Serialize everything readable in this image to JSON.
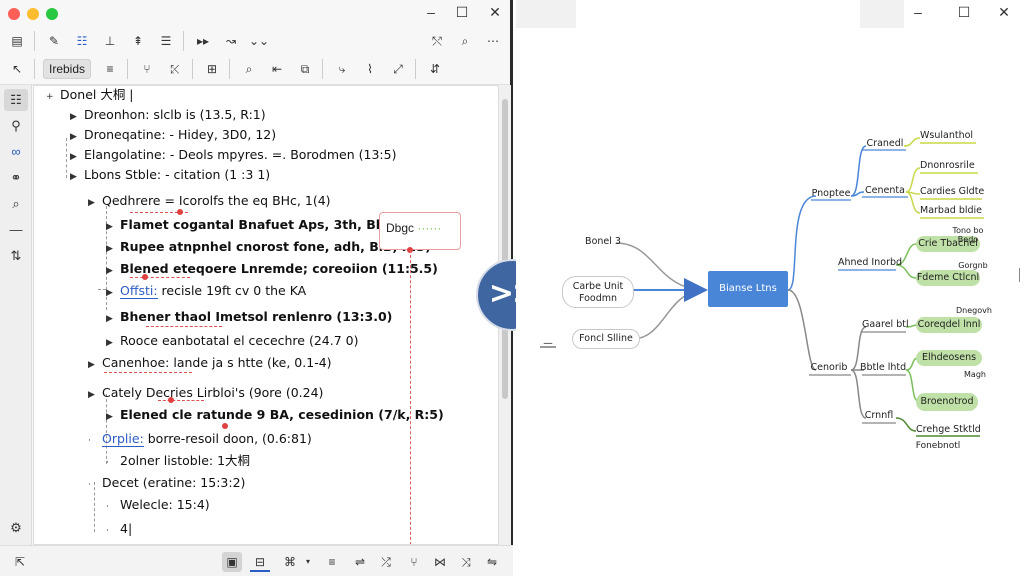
{
  "window": {
    "controls": {
      "minimize": "–",
      "maximize": "☐",
      "close": "✕"
    }
  },
  "toolbar1": {
    "icons": [
      "doc-icon",
      "pen-icon",
      "indent-icon",
      "align-icon",
      "align2-icon",
      "list-icon",
      "more-icon",
      "arrow-icon",
      "chevron-icon",
      "format-icon",
      "search-icon",
      "overflow-icon"
    ]
  },
  "toolbar2": {
    "label": "Irebids"
  },
  "outline": {
    "root": "Donel 大桐 |",
    "rows": [
      {
        "text": "Dreonhon: slclb is (13.5, R:1)"
      },
      {
        "text": "Droneqatine: - Hidey, 3D0, 12)"
      },
      {
        "text": "Elangolatine: - Deols mpyres. =. Borodmen (13:5)"
      },
      {
        "text": "Lbons Stble: - citation (1 :3 1)"
      },
      {
        "text": "Qedhrere = Icorolfs the eq BHc, 1(4)"
      },
      {
        "text": "Flamet cogantal Bnafuet Aps, 3th, Bky, K.A,"
      },
      {
        "text": "Rupee atnpnhel cnorost fone, adh, BlB, K:3)"
      },
      {
        "text": "Blened eteqoere Lnremde; coreoiion (11:5.5)"
      },
      {
        "link": "Offsti:",
        "text": " recisle 19ft cv 0 the KA"
      },
      {
        "text": "Bhener thaol Imetsol renlenro (13:3.0)"
      },
      {
        "text": "Rooce eanbotatal el cecechre (24.7 0)"
      },
      {
        "text": "Canenhoe: lande ja s htte (ke, 0.1-4)"
      },
      {
        "text": "Cately Decries Lirbloi's (9ore (0.24)"
      },
      {
        "text": "Elened cle ratunde 9 BA, cesedinion (7/k, R:5)"
      },
      {
        "link": "Orplie:",
        "text": " borre-resoil doon, (0.6:81)"
      },
      {
        "text": "2olner listoble: 1大桐"
      },
      {
        "text": "Decet (eratine: 15:3:2)"
      },
      {
        "text": "Welecle: 15:4)"
      },
      {
        "text": "4|"
      }
    ],
    "note": "Dbgc"
  },
  "mindmap": {
    "center": "Bianse Ltns",
    "left_nodes": [
      "Bonel 3",
      "Carbe Unit\nFoodmn",
      "Foncl Slline"
    ],
    "left_tail": "—",
    "b1": "Pnoptee",
    "b1_children": [
      "Cranedl",
      "Cenenta"
    ],
    "b1_leaves": [
      "Wsulanthol",
      "Dnonrosrile",
      "Cardies Gldte",
      "Marbad bldie"
    ],
    "b2": "Ahned Inorbd",
    "b2_leaves": [
      "Crie Tbacnel",
      "Fdeme Ctlcnl"
    ],
    "b2_small": [
      "Tono bo\nBedo",
      "Gorgnb"
    ],
    "b3": "Cenorib",
    "b3_children": [
      "Gaarel btl",
      "Bbtle lhtd",
      "Crnnfl"
    ],
    "b3_leaves": [
      "Coreqdel lnnl",
      "Elhdeosens",
      "Broenotrod",
      "Crehge Stktld"
    ],
    "b3_small": [
      "Dnegovh",
      "Magh",
      "Fonebnotl"
    ]
  },
  "colors": {
    "accent": "#4a86d8",
    "toggle": "#3f66a0",
    "yellow_branch": "#c9d84a",
    "green_branch": "#7bbf5a",
    "green_pill": "#bfe0a6",
    "link": "#2c5cc5",
    "red": "#e04040"
  }
}
